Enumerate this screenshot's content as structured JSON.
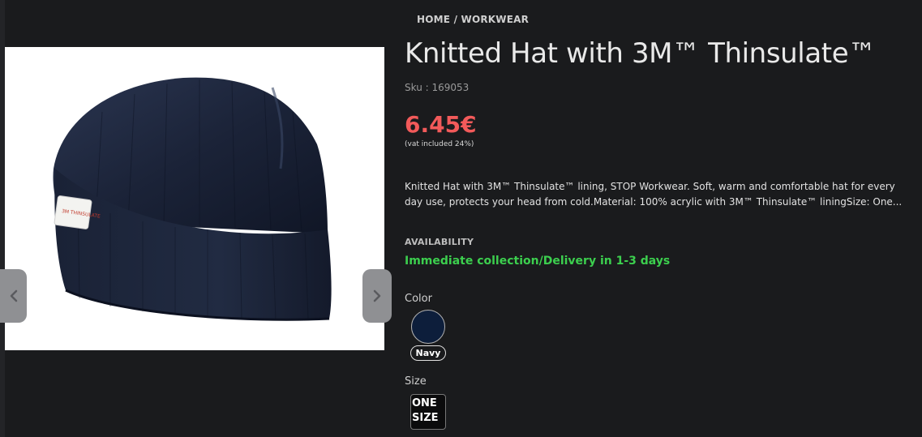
{
  "breadcrumb": {
    "home": "HOME",
    "separator": " / ",
    "category": "WORKWEAR"
  },
  "product": {
    "title": "Knitted Hat with 3M™ Thinsulate™",
    "sku_label": "Sku : 169053",
    "price": "6.45€",
    "vat_note": "(vat included 24%)",
    "description": "Knitted Hat with 3M™ Thinsulate™ lining, STOP Workwear. Soft, warm and comfortable hat for every day use, protects your head from cold.Material: 100% acrylic with 3M™ Thinsulate™ liningSize: One...",
    "image_label_text": "3M THINSULATE"
  },
  "availability": {
    "label": "AVAILABILITY",
    "value": "Immediate collection/Delivery in 1-3 days"
  },
  "color": {
    "label": "Color",
    "selected_name": "Navy",
    "swatch_hex": "#0d1e3b"
  },
  "size": {
    "label": "Size",
    "line1": "ONE",
    "line2": "SIZE"
  },
  "gallery": {
    "prev_icon": "chevron-left-icon",
    "next_icon": "chevron-right-icon"
  },
  "colors": {
    "background": "#1a1b1d",
    "price": "#f25a5a",
    "availability": "#3ccf4e"
  }
}
